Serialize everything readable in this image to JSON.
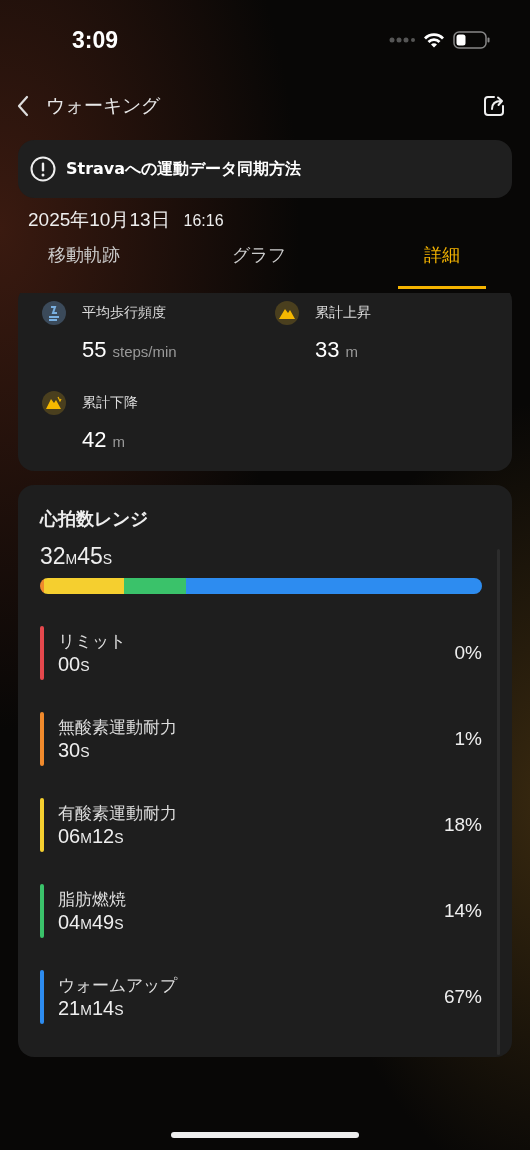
{
  "status_bar": {
    "time": "3:09"
  },
  "nav": {
    "title": "ウォーキング"
  },
  "banner": {
    "text": "Stravaへの運動データ同期方法"
  },
  "date": {
    "day": "2025年10月13日",
    "time": "16:16"
  },
  "tabs": [
    {
      "label": "移動軌跡",
      "selected": false
    },
    {
      "label": "グラフ",
      "selected": false
    },
    {
      "label": "詳細",
      "selected": true
    }
  ],
  "stats": [
    {
      "kind": "cadence",
      "label": "平均歩行頻度",
      "value": "55",
      "unit": "steps/min"
    },
    {
      "kind": "ascent",
      "label": "累計上昇",
      "value": "33",
      "unit": "m"
    },
    {
      "kind": "descent",
      "label": "累計下降",
      "value": "42",
      "unit": "m"
    }
  ],
  "heart_rate": {
    "title": "心拍数レンジ",
    "total": [
      {
        "num": "32",
        "unit": "M"
      },
      {
        "num": "45",
        "unit": "S"
      }
    ],
    "zones": [
      {
        "name": "リミット",
        "color": "#e5484d",
        "duration": [
          {
            "num": "00",
            "unit": "S"
          }
        ],
        "percent": "0%"
      },
      {
        "name": "無酸素運動耐力",
        "color": "#f08a2c",
        "duration": [
          {
            "num": "30",
            "unit": "S"
          }
        ],
        "percent": "1%"
      },
      {
        "name": "有酸素運動耐力",
        "color": "#f5cf2f",
        "duration": [
          {
            "num": "06",
            "unit": "M"
          },
          {
            "num": "12",
            "unit": "S"
          }
        ],
        "percent": "18%"
      },
      {
        "name": "脂肪燃焼",
        "color": "#3ac26a",
        "duration": [
          {
            "num": "04",
            "unit": "M"
          },
          {
            "num": "49",
            "unit": "S"
          }
        ],
        "percent": "14%"
      },
      {
        "name": "ウォームアップ",
        "color": "#2d8cf0",
        "duration": [
          {
            "num": "21",
            "unit": "M"
          },
          {
            "num": "14",
            "unit": "S"
          }
        ],
        "percent": "67%"
      }
    ]
  }
}
